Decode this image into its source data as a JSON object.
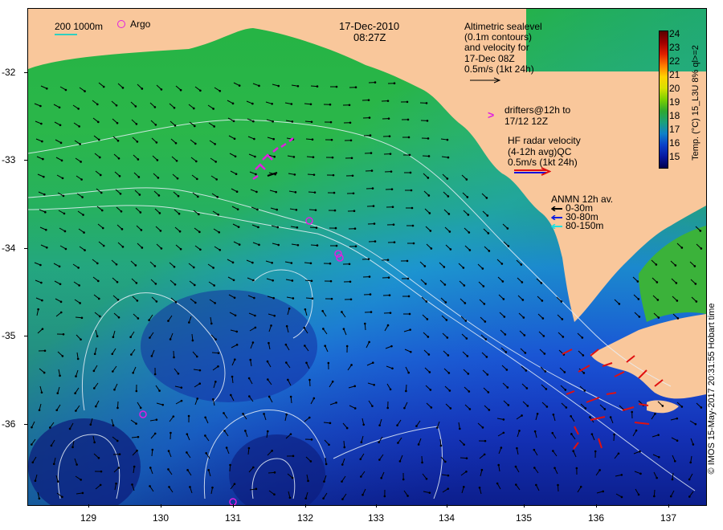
{
  "header": {
    "date": "17-Dec-2010",
    "time": "08:27Z"
  },
  "legend": {
    "isobath": "200  1000m",
    "argo": "Argo",
    "altimetry": [
      "Altimetric sealevel",
      "(0.1m contours)",
      "and velocity for",
      "17-Dec 08Z",
      "0.5m/s (1kt 24h)"
    ],
    "drifters": [
      "drifters@12h to",
      "17/12 12Z"
    ],
    "drifter_marker": ">",
    "hf_radar": [
      "HF radar velocity",
      "(4-12h avg)QC",
      "0.5m/s (1kt 24h)"
    ],
    "anmn": [
      "ANMN 12h av.",
      "0-30m",
      "30-80m",
      "80-150m"
    ]
  },
  "colorbar": {
    "title": "Temp. (°C) 15_L3U 8% ql>=2",
    "ticks": [
      "24",
      "23",
      "22",
      "21",
      "20",
      "19",
      "18",
      "17",
      "16",
      "15"
    ]
  },
  "axes": {
    "y_labels": [
      "-32",
      "-33",
      "-34",
      "-35",
      "-36"
    ],
    "x_labels": [
      "129",
      "130",
      "131",
      "132",
      "133",
      "134",
      "135",
      "136",
      "137"
    ]
  },
  "copyright": "© IMOS 15-May-2017 20:31:55 Hobart time",
  "colors": {
    "land": "#f9c79b",
    "warm_water": "#22c24a",
    "mid_water": "#1fa0b8",
    "cold_water": "#1a2fb0",
    "argo_marker": "#e020e0",
    "hf_radar": "#e01010",
    "contour": "#e8f0f8"
  }
}
